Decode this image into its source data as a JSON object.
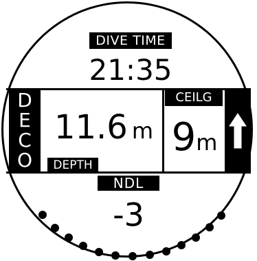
{
  "dive_time": {
    "label": "DIVE TIME",
    "value": "21:35"
  },
  "deco": {
    "letters": [
      "D",
      "E",
      "C",
      "O"
    ]
  },
  "depth": {
    "value": "11.6",
    "unit": "m",
    "label": "DEPTH"
  },
  "ceiling": {
    "label": "CEILG",
    "value": "9",
    "unit": "m",
    "arrow_icon": "ascend-arrow-icon"
  },
  "ndl": {
    "label": "NDL",
    "value": "-3"
  },
  "colors": {
    "foreground": "#000000",
    "background": "#ffffff"
  }
}
